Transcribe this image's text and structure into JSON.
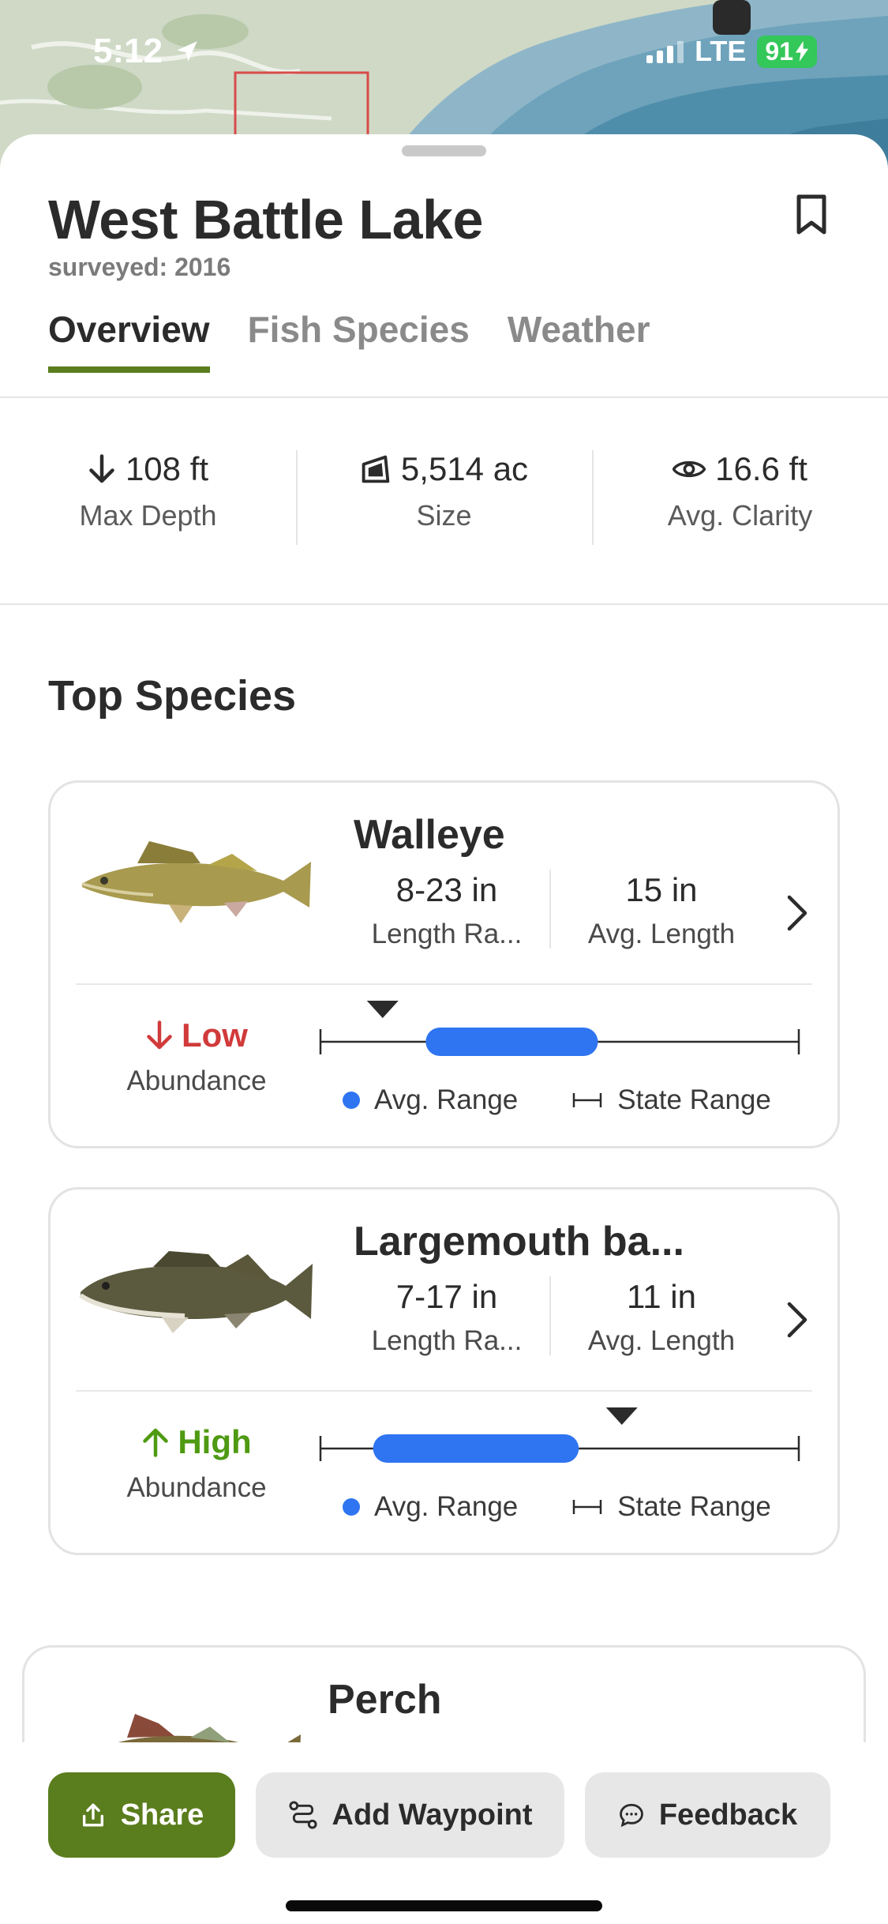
{
  "status_bar": {
    "time": "5:12",
    "network": "LTE",
    "battery": "91"
  },
  "lake": {
    "name": "West Battle Lake",
    "surveyed": "surveyed: 2016"
  },
  "tabs": [
    {
      "label": "Overview",
      "active": true
    },
    {
      "label": "Fish Species",
      "active": false
    },
    {
      "label": "Weather",
      "active": false
    }
  ],
  "stats": [
    {
      "icon": "arrow-down-icon",
      "value": "108 ft",
      "label": "Max Depth"
    },
    {
      "icon": "area-icon",
      "value": "5,514 ac",
      "label": "Size"
    },
    {
      "icon": "eye-icon",
      "value": "16.6 ft",
      "label": "Avg. Clarity"
    }
  ],
  "section_title": "Top Species",
  "species": [
    {
      "name": "Walleye",
      "length_range": "8-23 in",
      "length_range_label": "Length Ra...",
      "avg_length": "15 in",
      "avg_length_label": "Avg. Length",
      "abundance": "Low",
      "abundance_label": "Abundance",
      "abundance_color": "#d13a3a",
      "range_marker_fraction": 0.13,
      "avg_range_fraction": [
        0.22,
        0.58
      ]
    },
    {
      "name": "Largemouth ba...",
      "length_range": "7-17 in",
      "length_range_label": "Length Ra...",
      "avg_length": "11 in",
      "avg_length_label": "Avg. Length",
      "abundance": "High",
      "abundance_label": "Abundance",
      "abundance_color": "#4e9a12",
      "range_marker_fraction": 0.63,
      "avg_range_fraction": [
        0.11,
        0.54
      ]
    },
    {
      "name": "Perch"
    }
  ],
  "legend": {
    "avg_range": "Avg. Range",
    "state_range": "State Range"
  },
  "actions": {
    "share": "Share",
    "add_waypoint": "Add Waypoint",
    "feedback": "Feedback"
  },
  "colors": {
    "accent": "#5a7d1d",
    "range_bar": "#2f75f1"
  }
}
